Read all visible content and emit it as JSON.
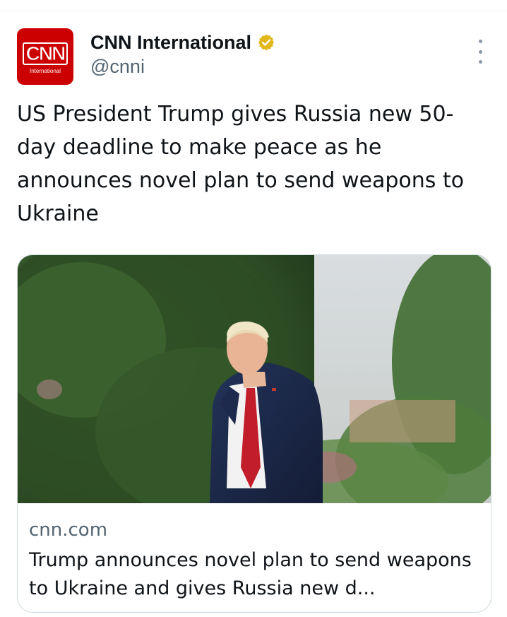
{
  "author": {
    "display_name": "CNN International",
    "handle": "@cnni",
    "verified": true,
    "verified_badge_color": "#e2b719",
    "avatar": {
      "logo_text": "CNN",
      "logo_subtext": "International",
      "background_color": "#cc0000"
    }
  },
  "more_icon": "more-vertical-icon",
  "tweet": {
    "text": "US President Trump gives Russia new 50-day deadline to make peace as he announces novel plan to send weapons to Ukraine"
  },
  "card": {
    "image_icon": "photo-image",
    "domain": "cnn.com",
    "title": "Trump announces novel plan to send weapons to Ukraine and gives Russia new d..."
  }
}
